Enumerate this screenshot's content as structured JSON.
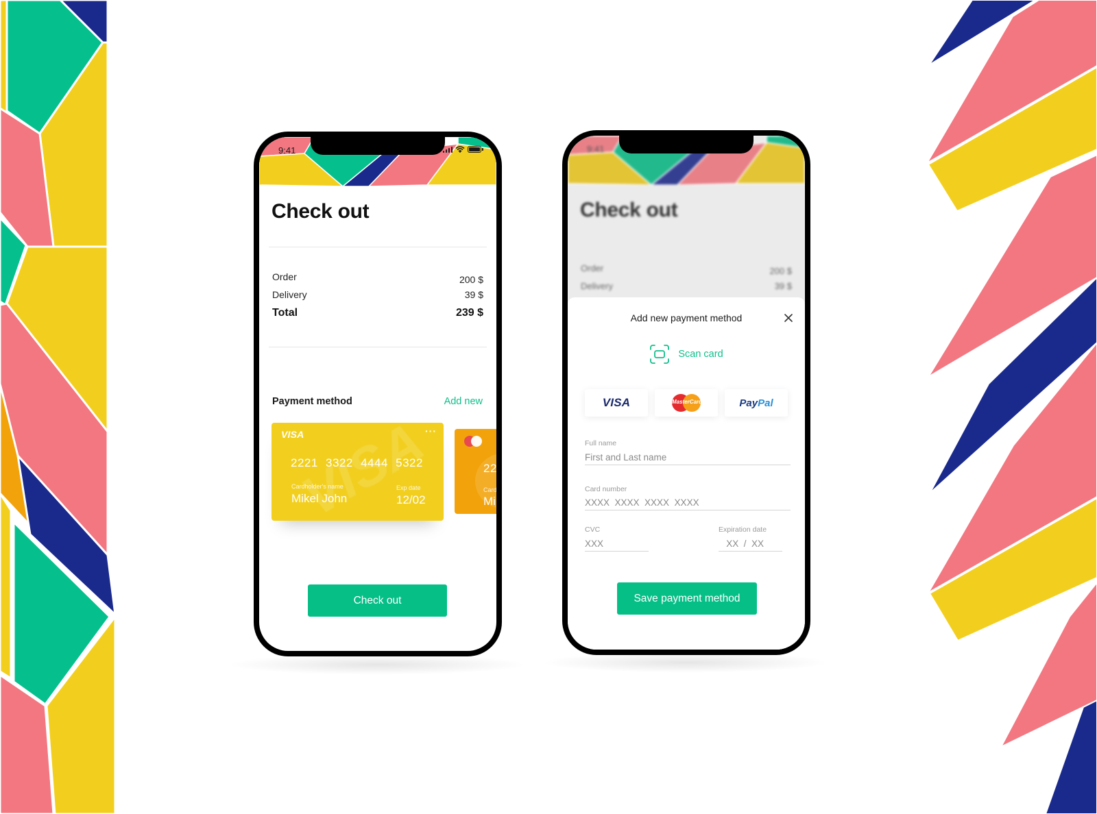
{
  "colors": {
    "accent_green": "#06bf87",
    "link_green": "#0fbf8a",
    "yellow": "#f2cf1f",
    "pink": "#f27781",
    "navy": "#1a2a8c",
    "teal": "#05c08d",
    "orange": "#f2a20a"
  },
  "phone_checkout": {
    "status_bar": {
      "time": "9:41",
      "icons": [
        "signal-icon",
        "wifi-icon",
        "battery-icon"
      ]
    },
    "title": "Check out",
    "summary": [
      {
        "label": "Order",
        "value": "200 $"
      },
      {
        "label": "Delivery",
        "value": "39 $"
      }
    ],
    "total": {
      "label": "Total",
      "value": "239 $"
    },
    "payment_section": {
      "title": "Payment method",
      "add_new": "Add new"
    },
    "cards": [
      {
        "brand": "VISA",
        "menu": "···",
        "number": "2221 3322 4444 5322",
        "holder_label": "Cardholder's name",
        "holder": "Mikel John",
        "exp_label": "Exp date",
        "exp": "12/02"
      },
      {
        "brand": "mastercard",
        "number_partial": "22",
        "holder_label_partial": "Card",
        "holder_partial": "Mi"
      }
    ],
    "checkout_button": "Check out"
  },
  "phone_add_payment": {
    "status_bar": {
      "time": "9:41"
    },
    "background": {
      "title": "Check out",
      "summary": [
        {
          "label": "Order",
          "value": "200 $"
        },
        {
          "label": "Delivery",
          "value": "39 $"
        }
      ]
    },
    "sheet": {
      "title": "Add new payment method",
      "scan_label": "Scan card",
      "methods": [
        {
          "name": "visa",
          "label": "VISA"
        },
        {
          "name": "mastercard",
          "label": "MasterCard"
        },
        {
          "name": "paypal",
          "label_part1": "Pay",
          "label_part2": "Pal"
        }
      ],
      "fields": {
        "full_name": {
          "label": "Full name",
          "placeholder": "First and Last name",
          "value": ""
        },
        "card_number": {
          "label": "Card number",
          "placeholder": "XXXX  XXXX  XXXX  XXXX",
          "value": ""
        },
        "cvc": {
          "label": "CVC",
          "placeholder": "XXX",
          "value": ""
        },
        "expiration": {
          "label": "Expiration date",
          "placeholder": "   XX  /  XX",
          "value": ""
        }
      },
      "save_button": "Save payment method"
    }
  }
}
